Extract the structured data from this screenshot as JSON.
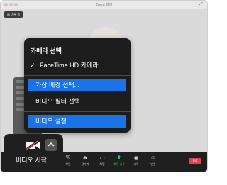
{
  "window": {
    "title": "Zoom 회의"
  },
  "status": {
    "label": "기록 중"
  },
  "toolbar": {
    "items": [
      {
        "label": "보안",
        "icon": "shield-icon"
      },
      {
        "label": "참가자",
        "icon": "participants-icon"
      },
      {
        "label": "채팅",
        "icon": "chat-icon"
      },
      {
        "label": "화면 공유",
        "icon": "share-screen-icon"
      },
      {
        "label": "기록",
        "icon": "record-icon"
      },
      {
        "label": "반응",
        "icon": "reactions-icon"
      }
    ],
    "end_label": "종료"
  },
  "camera_menu": {
    "header": "카메라 선택",
    "camera_option": "FaceTime HD 카메라",
    "virtual_background": "가상 배경 선택...",
    "video_filter": "비디오 필터 선택...",
    "video_settings": "비디오 설정..."
  },
  "video_control": {
    "label": "비디오 시작"
  },
  "colors": {
    "menu_background": "#1d1d1d",
    "selection_blue": "#1a74e8",
    "toolbar_background": "#1f1f1f",
    "end_red": "#e0414f"
  }
}
